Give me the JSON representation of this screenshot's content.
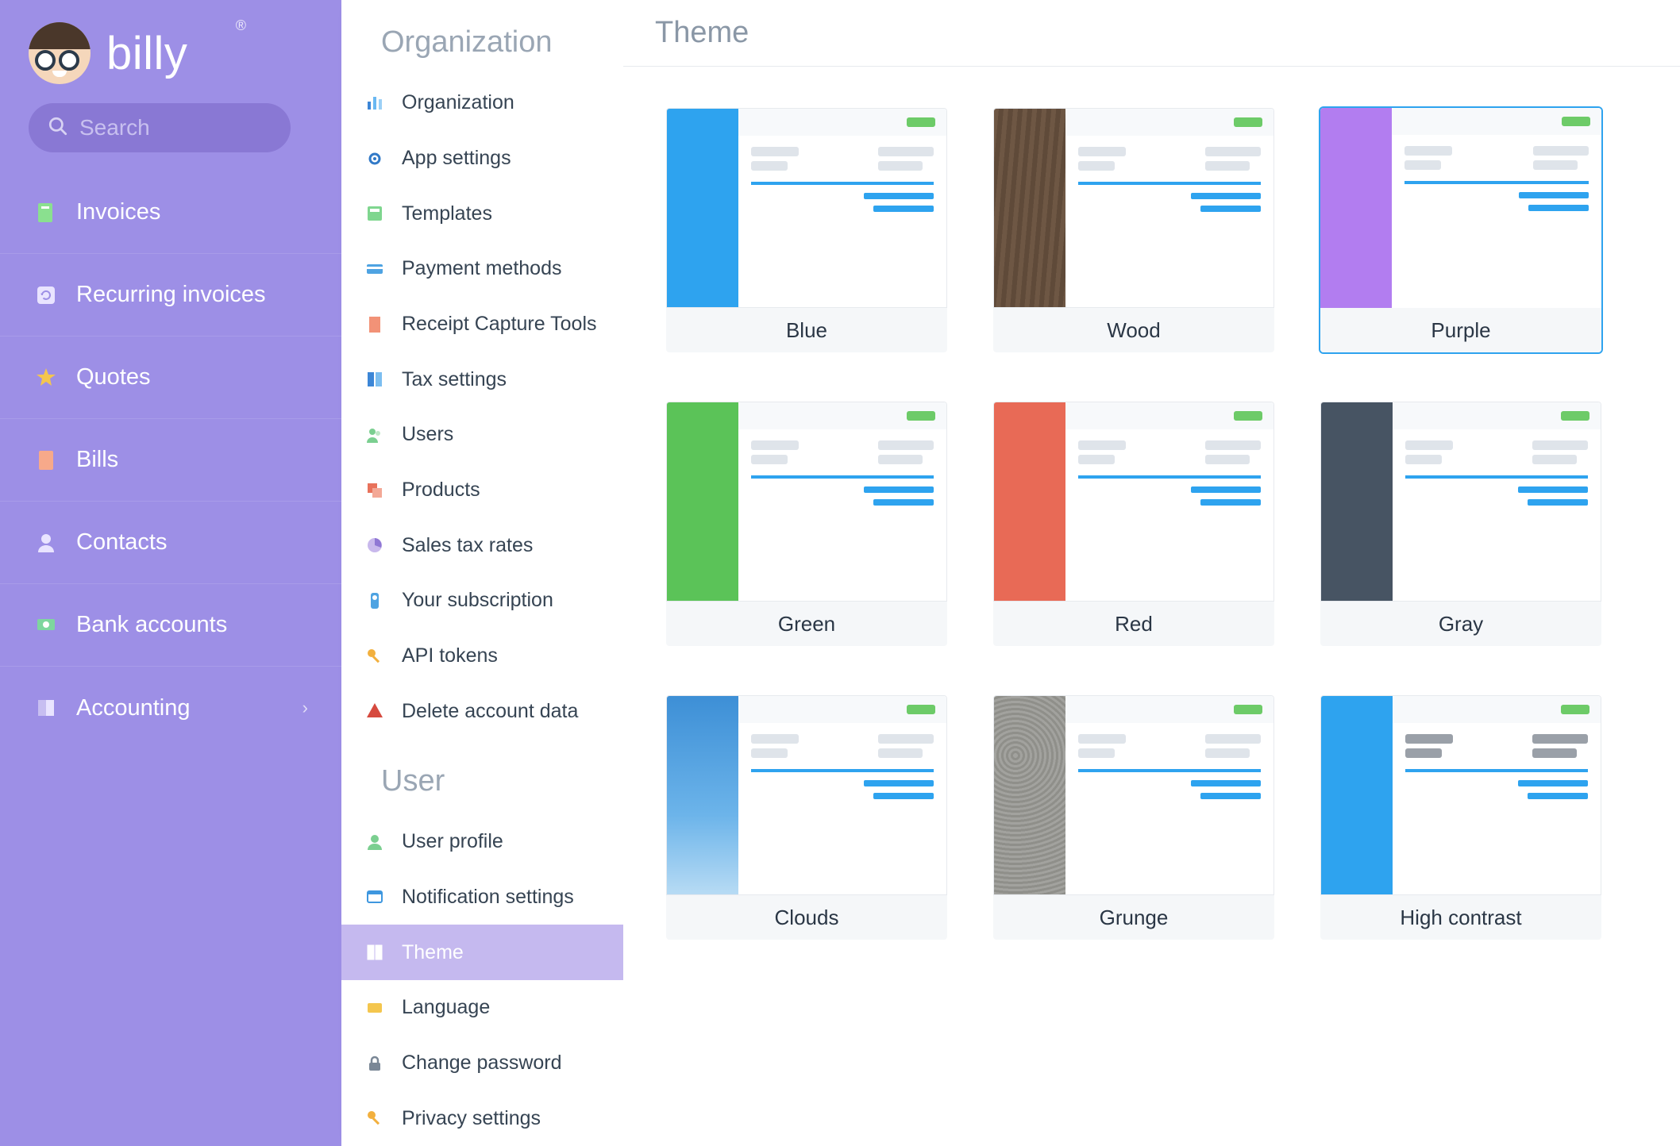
{
  "brand": {
    "name": "billy",
    "trademark": "®",
    "search_placeholder": "Search"
  },
  "nav": [
    {
      "label": "Invoices",
      "icon": "invoice",
      "expandable": false
    },
    {
      "label": "Recurring invoices",
      "icon": "recur",
      "expandable": false
    },
    {
      "label": "Quotes",
      "icon": "star",
      "expandable": false
    },
    {
      "label": "Bills",
      "icon": "bill",
      "expandable": false
    },
    {
      "label": "Contacts",
      "icon": "contact",
      "expandable": false
    },
    {
      "label": "Bank accounts",
      "icon": "bank",
      "expandable": false
    },
    {
      "label": "Accounting",
      "icon": "book",
      "expandable": true
    }
  ],
  "settings": {
    "groups": [
      {
        "title": "Organization",
        "items": [
          {
            "label": "Organization",
            "icon": "bars",
            "active": false
          },
          {
            "label": "App settings",
            "icon": "gear",
            "active": false
          },
          {
            "label": "Templates",
            "icon": "template",
            "active": false
          },
          {
            "label": "Payment methods",
            "icon": "card",
            "active": false
          },
          {
            "label": "Receipt Capture Tools",
            "icon": "receipt",
            "active": false
          },
          {
            "label": "Tax settings",
            "icon": "tax",
            "active": false
          },
          {
            "label": "Users",
            "icon": "users",
            "active": false
          },
          {
            "label": "Products",
            "icon": "product",
            "active": false
          },
          {
            "label": "Sales tax rates",
            "icon": "pie",
            "active": false
          },
          {
            "label": "Your subscription",
            "icon": "sub",
            "active": false
          },
          {
            "label": "API tokens",
            "icon": "key",
            "active": false
          },
          {
            "label": "Delete account data",
            "icon": "warn",
            "active": false
          }
        ]
      },
      {
        "title": "User",
        "items": [
          {
            "label": "User profile",
            "icon": "user",
            "active": false
          },
          {
            "label": "Notification settings",
            "icon": "bell",
            "active": false
          },
          {
            "label": "Theme",
            "icon": "theme",
            "active": true
          },
          {
            "label": "Language",
            "icon": "lang",
            "active": false
          },
          {
            "label": "Change password",
            "icon": "lock",
            "active": false
          },
          {
            "label": "Privacy settings",
            "icon": "key",
            "active": false
          }
        ]
      }
    ]
  },
  "page": {
    "title": "Theme",
    "themes": [
      {
        "label": "Blue",
        "accent": "#2ea3ef",
        "texture": "solid",
        "selected": false
      },
      {
        "label": "Wood",
        "accent": "#6d5542",
        "texture": "wood",
        "selected": false
      },
      {
        "label": "Purple",
        "accent": "#b27df0",
        "texture": "solid",
        "selected": true
      },
      {
        "label": "Green",
        "accent": "#5bc358",
        "texture": "solid",
        "selected": false
      },
      {
        "label": "Red",
        "accent": "#e86a56",
        "texture": "solid",
        "selected": false
      },
      {
        "label": "Gray",
        "accent": "#475463",
        "texture": "solid",
        "selected": false
      },
      {
        "label": "Clouds",
        "accent": "#4ba1e2",
        "texture": "clouds",
        "selected": false
      },
      {
        "label": "Grunge",
        "accent": "#9a9a97",
        "texture": "grunge",
        "selected": false
      },
      {
        "label": "High contrast",
        "accent": "#2ea3ef",
        "texture": "solid",
        "selected": false,
        "high_contrast": true
      }
    ]
  }
}
